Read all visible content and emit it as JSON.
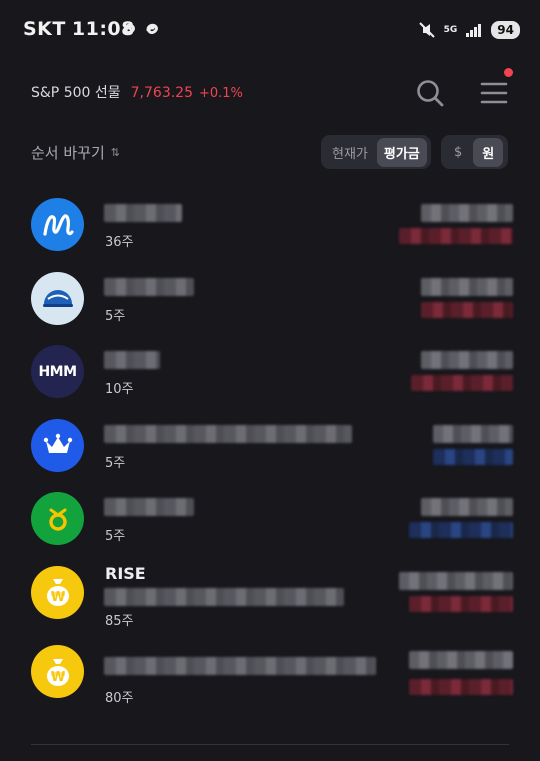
{
  "status_bar": {
    "carrier": "SKT",
    "time": "11:08",
    "network": "5G",
    "battery": "94"
  },
  "header": {
    "index_name": "S&P 500 선물",
    "index_value": "7,763.25",
    "index_change": "+0.1%",
    "accent_up": "#f04452",
    "accent_down": "#3182f6"
  },
  "toolbar": {
    "sort_label": "순서 바꾸기",
    "sort_icon": "up-down-arrows-icon",
    "price_toggle": [
      "현재가",
      "평가금"
    ],
    "price_selected": "평가금",
    "currency_toggle": [
      "$",
      "원"
    ],
    "currency_selected": "원"
  },
  "holdings": [
    {
      "logo": "nu-logo",
      "logo_color": "#1e7fe6",
      "label": "",
      "quantity": "36주",
      "change_dir": "up"
    },
    {
      "logo": "globe-logo",
      "logo_color": "#d7e6f0",
      "label": "",
      "quantity": "5주",
      "change_dir": "up"
    },
    {
      "logo": "hmm-logo",
      "logo_color": "#242450",
      "logo_text": "HMM",
      "label": "",
      "quantity": "10주",
      "change_dir": "up"
    },
    {
      "logo": "crown-logo",
      "logo_color": "#1f5be8",
      "label": "",
      "quantity": "5주",
      "change_dir": "down"
    },
    {
      "logo": "ring-logo",
      "logo_color": "#12a33c",
      "label": "",
      "quantity": "5주",
      "change_dir": "down"
    },
    {
      "logo": "won-bag-logo",
      "logo_color": "#f6c90e",
      "label": "RISE",
      "quantity": "85주",
      "change_dir": "up"
    },
    {
      "logo": "won-bag-logo",
      "logo_color": "#f6c90e",
      "label": "",
      "quantity": "80주",
      "change_dir": "up"
    }
  ]
}
